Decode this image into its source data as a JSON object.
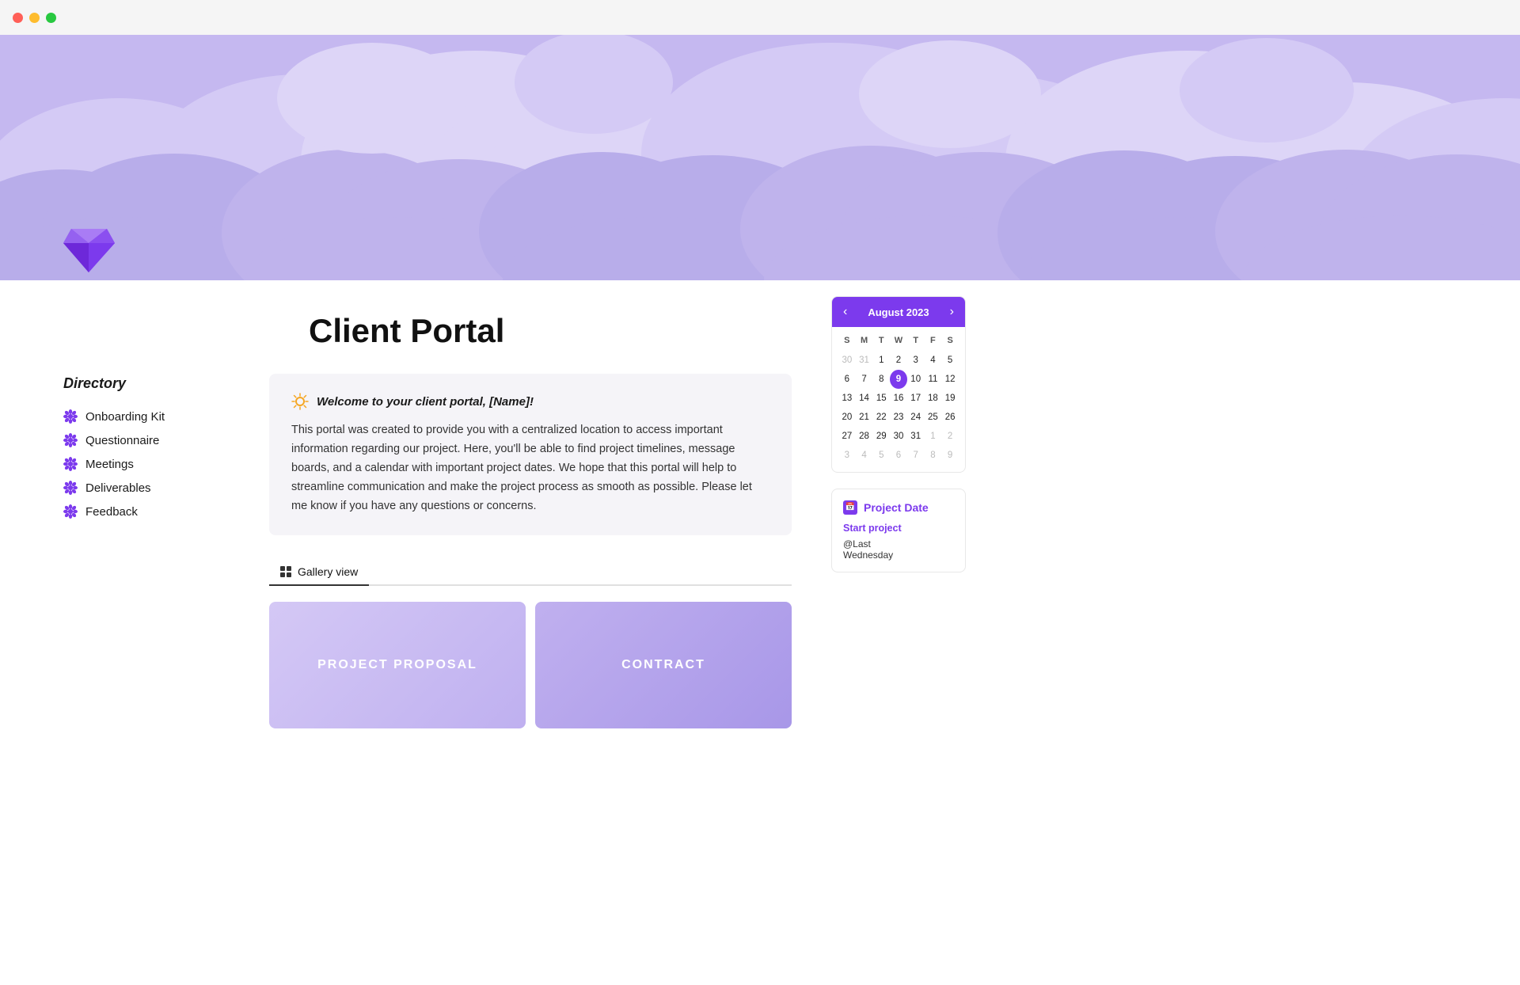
{
  "titlebar": {
    "dots": [
      "red",
      "yellow",
      "green"
    ]
  },
  "hero": {
    "bg_color": "#c5b8f0"
  },
  "diamond": {
    "label": "diamond-icon"
  },
  "page": {
    "title": "Client Portal"
  },
  "welcome": {
    "title": "Welcome to your client portal, [Name]!",
    "body": "This portal was created to provide you with a centralized location to access important information regarding our project. Here, you'll be able to find project timelines, message boards, and a calendar with important project dates. We hope that this portal will help to streamline communication and make the project process as smooth as possible. Please let me know if you have any questions or concerns."
  },
  "gallery_tab": {
    "label": "Gallery view"
  },
  "gallery_cards": [
    {
      "id": "proposal",
      "label": "PROJECT PROPOSAL",
      "style": "proposal"
    },
    {
      "id": "contract",
      "label": "CONTRACT",
      "style": "contract"
    }
  ],
  "sidebar": {
    "title": "Directory",
    "items": [
      {
        "label": "Onboarding Kit"
      },
      {
        "label": "Questionnaire"
      },
      {
        "label": "Meetings"
      },
      {
        "label": "Deliverables"
      },
      {
        "label": "Feedback"
      }
    ]
  },
  "calendar": {
    "month_label": "August 2023",
    "weekdays": [
      "S",
      "M",
      "T",
      "W",
      "T",
      "F",
      "S"
    ],
    "rows": [
      [
        "30",
        "31",
        "1",
        "2",
        "3",
        "4",
        "5"
      ],
      [
        "6",
        "7",
        "8",
        "9",
        "10",
        "11",
        "12"
      ],
      [
        "13",
        "14",
        "15",
        "16",
        "17",
        "18",
        "19"
      ],
      [
        "20",
        "21",
        "22",
        "23",
        "24",
        "25",
        "26"
      ],
      [
        "27",
        "28",
        "29",
        "30",
        "31",
        "1",
        "2"
      ],
      [
        "3",
        "4",
        "5",
        "6",
        "7",
        "8",
        "9"
      ]
    ],
    "today": "9",
    "today_row": 1,
    "today_col": 3,
    "other_month_first_row": [
      0,
      1
    ],
    "other_month_last_rows": [
      4,
      5
    ],
    "last_row_other": [
      1,
      2,
      3,
      4,
      5,
      6
    ],
    "prev_label": "‹",
    "next_label": "›"
  },
  "project_date": {
    "section_title": "Project Date",
    "items": [
      {
        "label": "Start project"
      },
      {
        "label": "@Last Wednesday"
      }
    ]
  }
}
